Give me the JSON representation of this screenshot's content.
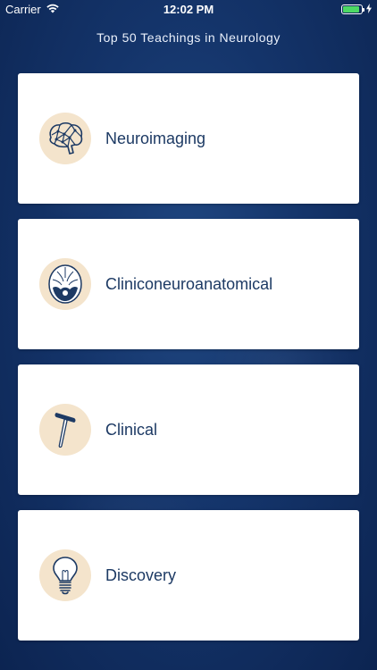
{
  "status_bar": {
    "carrier": "Carrier",
    "time": "12:02 PM"
  },
  "header": {
    "title": "Top 50 Teachings in Neurology"
  },
  "menu": {
    "items": [
      {
        "label": "Neuroimaging",
        "icon": "brain-icon"
      },
      {
        "label": "Cliniconeuroanatomical",
        "icon": "skull-base-icon"
      },
      {
        "label": "Clinical",
        "icon": "reflex-hammer-icon"
      },
      {
        "label": "Discovery",
        "icon": "lightbulb-icon"
      }
    ]
  },
  "colors": {
    "background": "#14346a",
    "card": "#ffffff",
    "icon_circle": "#f4e4cc",
    "icon_fg": "#1d3a64",
    "label": "#1d3a64",
    "battery": "#4cd964"
  }
}
